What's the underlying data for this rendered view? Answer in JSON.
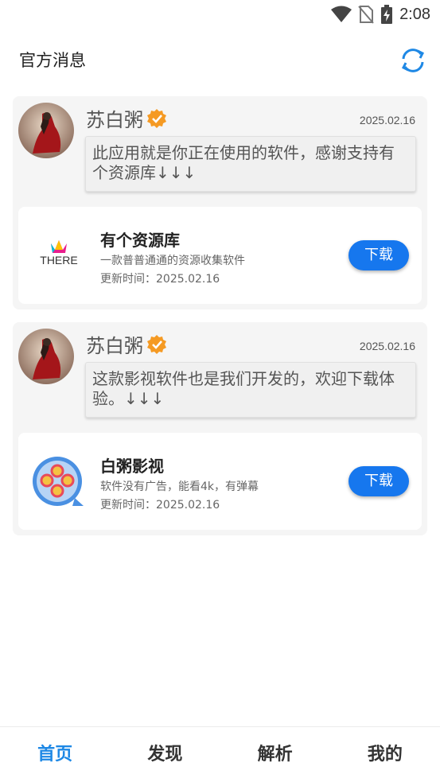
{
  "status_bar": {
    "time": "2:08"
  },
  "header": {
    "title": "官方消息"
  },
  "posts": [
    {
      "author": "苏白粥",
      "date": "2025.02.16",
      "message": "此应用就是你正在使用的软件，感谢支持有个资源库↓↓↓",
      "app": {
        "icon": "there-logo",
        "icon_text": "THERE",
        "name": "有个资源库",
        "description": "一款普普通通的资源收集软件",
        "updated": "更新时间：2025.02.16",
        "download_label": "下载"
      }
    },
    {
      "author": "苏白粥",
      "date": "2025.02.16",
      "message": "这款影视软件也是我们开发的，欢迎下载体验。↓↓↓",
      "app": {
        "icon": "film-reel-icon",
        "name": "白粥影视",
        "description": "软件没有广告，能看4k，有弹幕",
        "updated": "更新时间：2025.02.16",
        "download_label": "下载"
      }
    }
  ],
  "bottom_nav": [
    {
      "label": "首页",
      "active": true
    },
    {
      "label": "发现",
      "active": false
    },
    {
      "label": "解析",
      "active": false
    },
    {
      "label": "我的",
      "active": false
    }
  ],
  "colors": {
    "accent": "#1e88e5",
    "button": "#1677ee",
    "verified": "#f59a23"
  }
}
